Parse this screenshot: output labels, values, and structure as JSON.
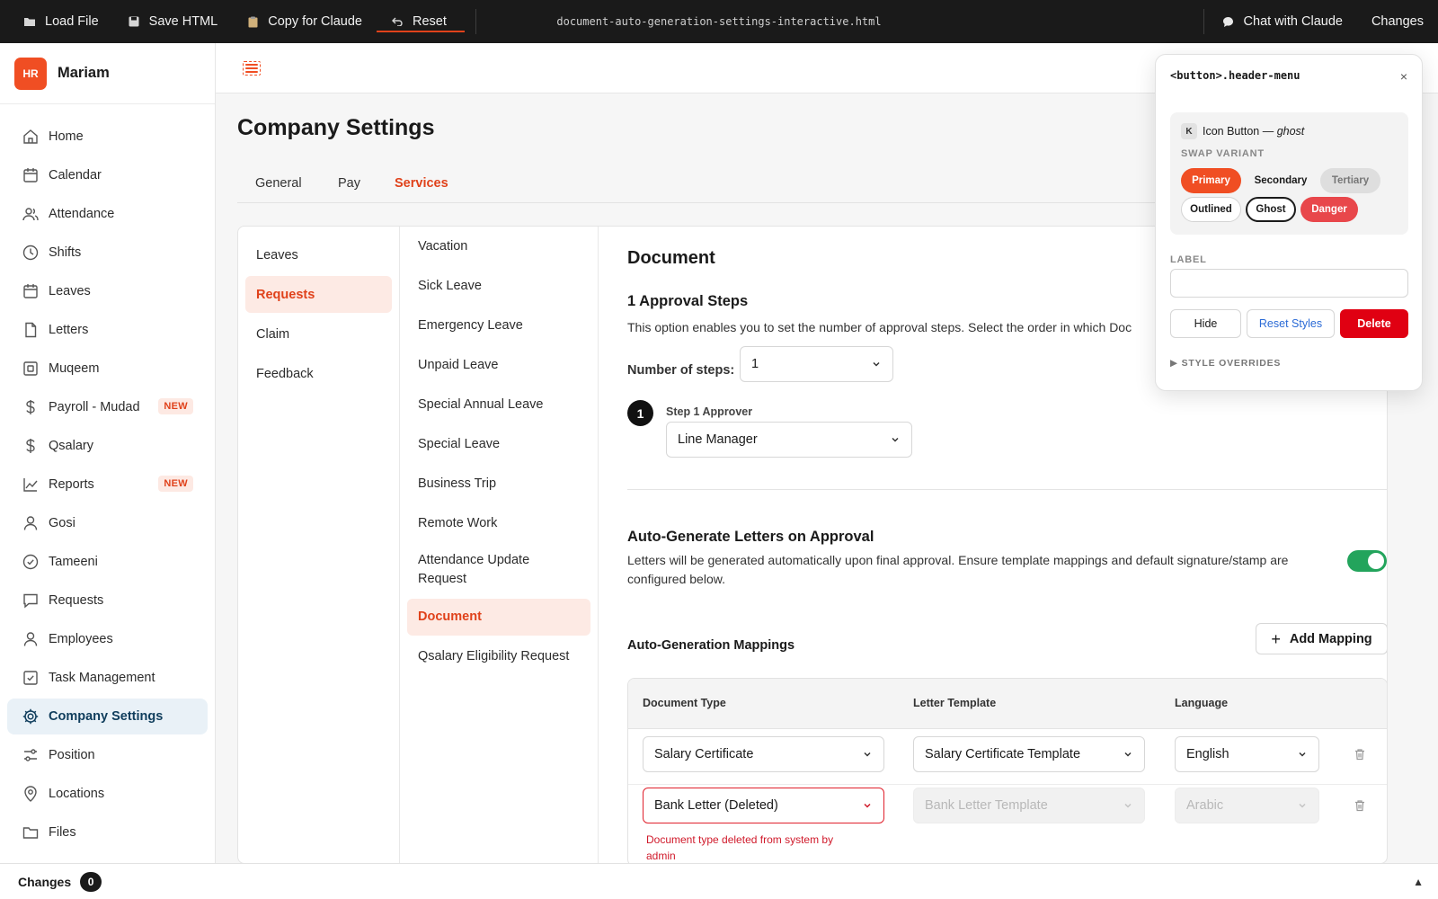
{
  "topbar": {
    "load_file": "Load File",
    "save_html": "Save HTML",
    "copy_for_claude": "Copy for Claude",
    "reset": "Reset",
    "filename": "document-auto-generation-settings-interactive.html",
    "chat": "Chat with Claude",
    "changes": "Changes"
  },
  "brand": {
    "logo": "HR",
    "name": "Mariam"
  },
  "sidebar": {
    "items": [
      {
        "label": "Home",
        "icon": "home-icon"
      },
      {
        "label": "Calendar",
        "icon": "calendar-icon"
      },
      {
        "label": "Attendance",
        "icon": "users-icon"
      },
      {
        "label": "Shifts",
        "icon": "clock-icon"
      },
      {
        "label": "Leaves",
        "icon": "calendar-icon"
      },
      {
        "label": "Letters",
        "icon": "file-icon"
      },
      {
        "label": "Muqeem",
        "icon": "id-card-icon"
      },
      {
        "label": "Payroll - Mudad",
        "icon": "dollar-icon",
        "badge": "NEW"
      },
      {
        "label": "Qsalary",
        "icon": "dollar-icon"
      },
      {
        "label": "Reports",
        "icon": "chart-icon",
        "badge": "NEW"
      },
      {
        "label": "Gosi",
        "icon": "user-icon"
      },
      {
        "label": "Tameeni",
        "icon": "check-circle-icon"
      },
      {
        "label": "Requests",
        "icon": "message-icon"
      },
      {
        "label": "Employees",
        "icon": "user-icon"
      },
      {
        "label": "Task Management",
        "icon": "checkbox-icon"
      },
      {
        "label": "Company Settings",
        "icon": "gear-icon",
        "active": true
      },
      {
        "label": "Position",
        "icon": "sliders-icon"
      },
      {
        "label": "Locations",
        "icon": "map-pin-icon"
      },
      {
        "label": "Files",
        "icon": "folder-icon"
      }
    ]
  },
  "page": {
    "title": "Company Settings",
    "tabs": [
      "General",
      "Pay",
      "Services"
    ],
    "active_tab": "Services"
  },
  "categories": [
    "Leaves",
    "Requests",
    "Claim",
    "Feedback"
  ],
  "request_types": [
    "Vacation",
    "Sick Leave",
    "Emergency Leave",
    "Unpaid Leave",
    "Special Annual Leave",
    "Special Leave",
    "Business Trip",
    "Remote Work",
    "Attendance Update Request",
    "Document",
    "Qsalary Eligibility Request"
  ],
  "document": {
    "title": "Document",
    "approval_heading": "1 Approval Steps",
    "approval_desc": "This option enables you to set the number of approval steps. Select the order in which Doc",
    "steps_label": "Number of steps:",
    "steps_value": "1",
    "step_number": "1",
    "step_label": "Step 1 Approver",
    "step_approver": "Line Manager",
    "auto_heading": "Auto-Generate Letters on Approval",
    "auto_desc": "Letters will be generated automatically upon final approval. Ensure template mappings and default signature/stamp are configured below.",
    "auto_enabled": true,
    "mappings_heading": "Auto-Generation Mappings",
    "add_mapping": "Add Mapping",
    "columns": [
      "Document Type",
      "Letter Template",
      "Language"
    ],
    "rows": [
      {
        "doc_type": "Salary Certificate",
        "template": "Salary Certificate Template",
        "language": "English"
      },
      {
        "doc_type": "Bank Letter (Deleted)",
        "template": "Bank Letter Template",
        "language": "Arabic",
        "error": "Document type deleted from system by admin"
      }
    ]
  },
  "inspector": {
    "title": "<button>.header-menu",
    "close": "×",
    "key_chip": "K",
    "component": "Icon Button —",
    "variant": "ghost",
    "swap_label": "SWAP VARIANT",
    "variants": [
      "Primary",
      "Secondary",
      "Tertiary",
      "Outlined",
      "Ghost",
      "Danger"
    ],
    "field_label": "LABEL",
    "label_value": "",
    "hide": "Hide",
    "reset_styles": "Reset Styles",
    "delete": "Delete",
    "overrides": "▶  STYLE OVERRIDES"
  },
  "footer": {
    "label": "Changes",
    "count": "0",
    "toggle": "▲"
  },
  "colors": {
    "accent": "#f04e23",
    "active_nav_bg": "#e9f1f7",
    "toggle_on": "#23a45c",
    "error": "#e0202c"
  }
}
